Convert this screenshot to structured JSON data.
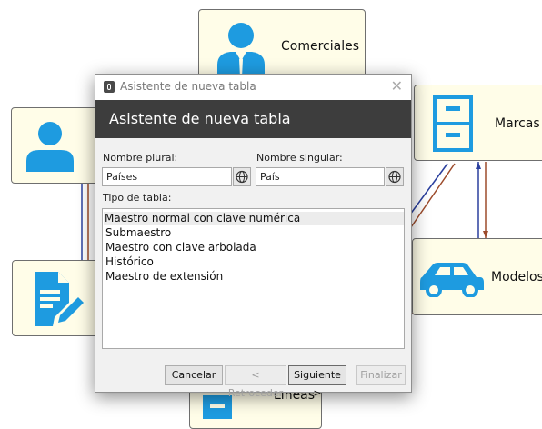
{
  "diagram": {
    "nodes": {
      "comerciales": {
        "label": "Comerciales",
        "icon": "salesperson-icon"
      },
      "user": {
        "icon": "user-icon"
      },
      "marcas": {
        "label": "Marcas",
        "icon": "file-cabinet-icon"
      },
      "document": {
        "icon": "document-edit-icon"
      },
      "modelos": {
        "label": "Modelos",
        "icon": "car-icon"
      },
      "lineas": {
        "label": "Líneas"
      }
    },
    "colors": {
      "icon": "#1e9be0",
      "node_fill": "#fffde8",
      "arrow_blue": "#2a3f9e",
      "arrow_red": "#9c4a2a"
    }
  },
  "dialog": {
    "window_title": "Asistente de nueva tabla",
    "header_title": "Asistente de nueva tabla",
    "plural_label": "Nombre plural:",
    "plural_value": "Países",
    "singular_label": "Nombre singular:",
    "singular_value": "País",
    "type_label": "Tipo de tabla:",
    "table_types": [
      "Maestro normal con clave numérica",
      "Submaestro",
      "Maestro con clave arbolada",
      "Histórico",
      "Maestro de extensión"
    ],
    "selected_index": 0,
    "buttons": {
      "cancel": "Cancelar",
      "back": "< Retroceder",
      "next": "Siguiente >",
      "finish": "Finalizar"
    }
  }
}
